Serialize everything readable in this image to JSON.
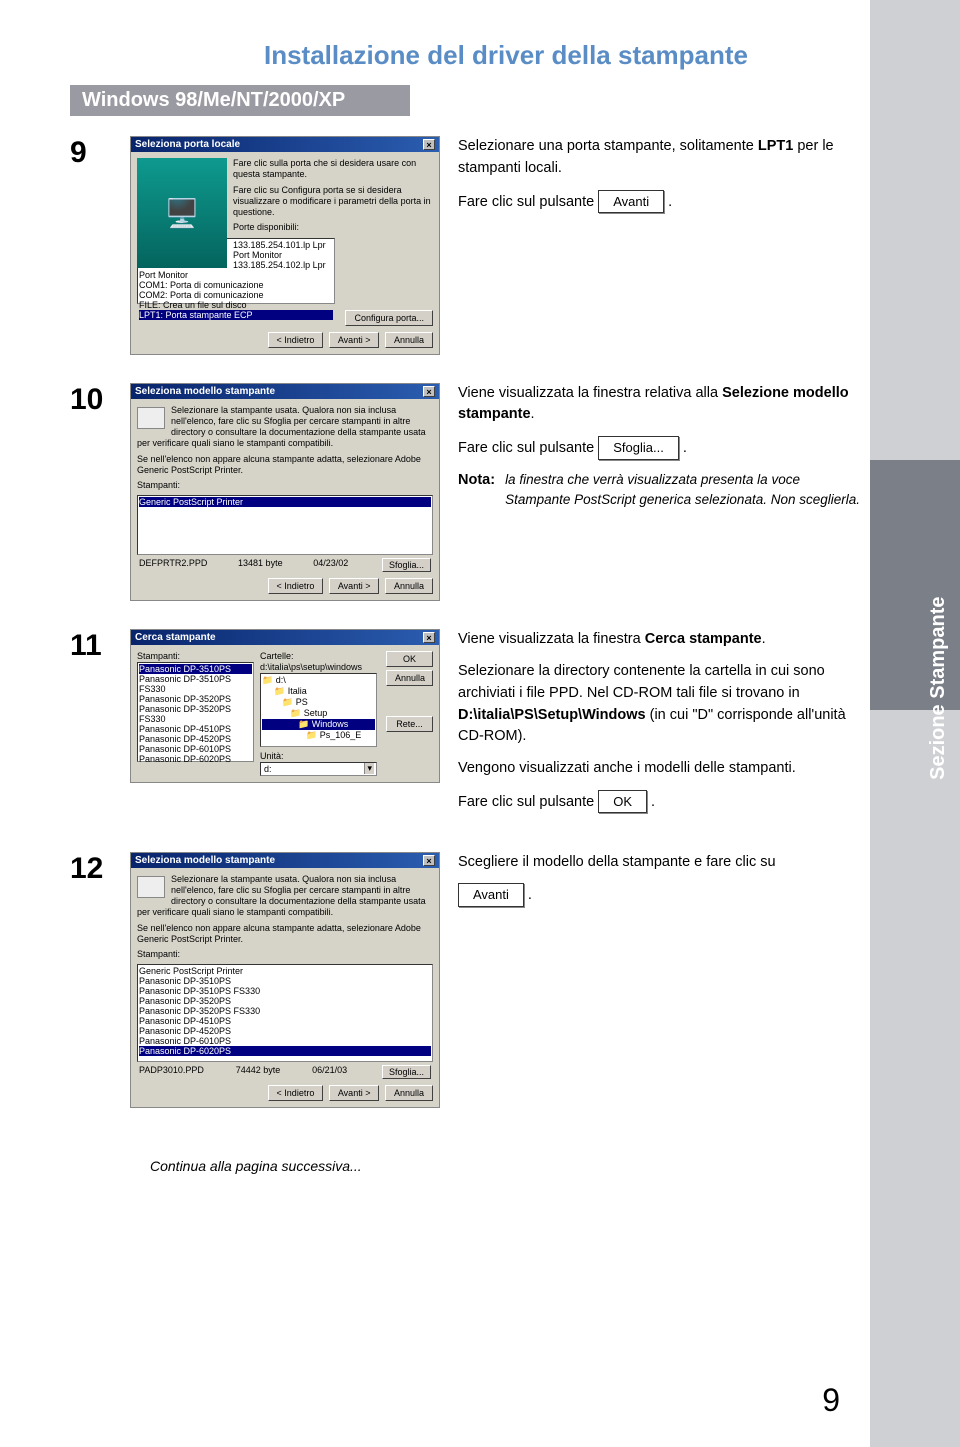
{
  "page": {
    "title": "Installazione del driver della stampante",
    "subtitle": "Windows 98/Me/NT/2000/XP",
    "side_label": "Sezione Stampante",
    "continue": "Continua alla pagina successiva...",
    "number": "9"
  },
  "buttons": {
    "avanti": "Avanti",
    "sfoglia": "Sfoglia...",
    "ok": "OK",
    "indietro": "< Indietro",
    "avanti_gt": "Avanti >",
    "annulla": "Annulla",
    "configura": "Configura porta...",
    "rete": "Rete..."
  },
  "step9": {
    "num": "9",
    "dlg_title": "Seleziona porta locale",
    "dlg_text1": "Fare clic sulla porta che si desidera usare con questa stampante.",
    "dlg_text2": "Fare clic su Configura porta se si desidera visualizzare o modificare i parametri della porta in questione.",
    "ports_label": "Porte disponibili:",
    "ports": [
      "133.185.254.101.lp Lpr Port Monitor",
      "133.185.254.102.lp Lpr Port Monitor",
      "COM1:   Porta di comunicazione",
      "COM2:   Porta di comunicazione",
      "FILE:     Crea un file sul disco",
      "LPT1:    Porta stampante ECP"
    ],
    "instr1a": "Selezionare una porta stampante, solitamente ",
    "instr1b": "LPT1",
    "instr1c": " per le stampanti locali.",
    "instr2": "Fare clic sul pulsante "
  },
  "step10": {
    "num": "10",
    "dlg_title": "Seleziona modello stampante",
    "dlg_text1": "Selezionare la stampante usata. Qualora non sia inclusa nell'elenco, fare clic su Sfoglia per cercare stampanti in altre directory o consultare la documentazione della stampante usata per verificare quali siano le stampanti compatibili.",
    "dlg_text2": "Se nell'elenco non appare alcuna stampante adatta, selezionare Adobe Generic PostScript Printer.",
    "list_label": "Stampanti:",
    "list_item": "Generic PostScript Printer",
    "file_name": "DEFPRTR2.PPD",
    "file_size": "13481 byte",
    "file_date": "04/23/02",
    "instr1a": "Viene visualizzata la finestra relativa alla ",
    "instr1b": "Selezione modello stampante",
    "instr2": "Fare clic sul pulsante ",
    "note_label": "Nota:",
    "note_text": "la finestra che verrà visualizzata presenta la voce Stampante PostScript generica selezionata. Non sceglierla."
  },
  "step11": {
    "num": "11",
    "dlg_title": "Cerca stampante",
    "stamp_label": "Stampanti:",
    "cart_label": "Cartelle:",
    "cart_path": "d:\\italia\\ps\\setup\\windows",
    "printers": [
      "Panasonic DP-3510PS",
      "Panasonic DP-3510PS FS330",
      "Panasonic DP-3520PS",
      "Panasonic DP-3520PS FS330",
      "Panasonic DP-4510PS",
      "Panasonic DP-4520PS",
      "Panasonic DP-6010PS",
      "Panasonic DP-6020PS"
    ],
    "tree": [
      "d:\\",
      "Italia",
      "PS",
      "Setup",
      "Windows",
      "Ps_106_E"
    ],
    "unit_label": "Unità:",
    "unit_value": "d:",
    "instr1a": "Viene visualizzata la finestra ",
    "instr1b": "Cerca stampante",
    "instr2a": "Selezionare la directory contenente la cartella in cui sono archiviati i file PPD. Nel CD-ROM tali file si trovano in ",
    "instr2b": "D:\\italia\\PS\\Setup\\Windows",
    "instr2c": " (in cui \"D\" corrisponde all'unità CD-ROM).",
    "instr3": "Vengono visualizzati anche i modelli delle stampanti.",
    "instr4": "Fare clic sul pulsante "
  },
  "step12": {
    "num": "12",
    "dlg_title": "Seleziona modello stampante",
    "list_label": "Stampanti:",
    "printers": [
      "Generic PostScript Printer",
      "Panasonic DP-3510PS",
      "Panasonic DP-3510PS FS330",
      "Panasonic DP-3520PS",
      "Panasonic DP-3520PS FS330",
      "Panasonic DP-4510PS",
      "Panasonic DP-4520PS",
      "Panasonic DP-6010PS",
      "Panasonic DP-6020PS"
    ],
    "file_name": "PADP3010.PPD",
    "file_size": "74442 byte",
    "file_date": "06/21/03",
    "instr1": "Scegliere il modello della stampante e fare clic su"
  }
}
